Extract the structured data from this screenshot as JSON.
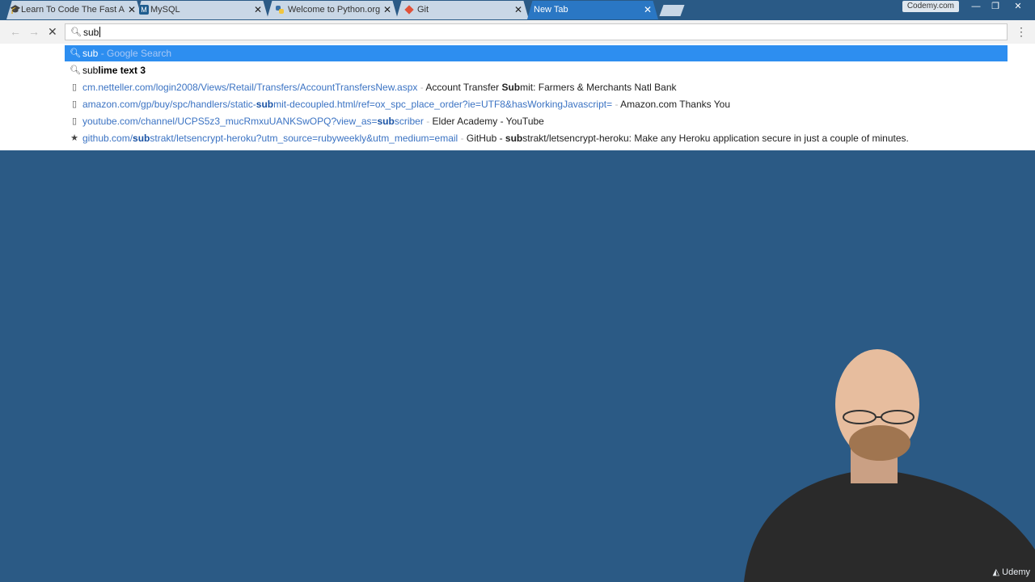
{
  "tabs": [
    {
      "title": "Learn To Code The Fast A",
      "icon": "graduation-cap-icon",
      "active": false
    },
    {
      "title": "MySQL",
      "icon": "mysql-icon",
      "active": false
    },
    {
      "title": "Welcome to Python.org",
      "icon": "python-icon",
      "active": false
    },
    {
      "title": "Git",
      "icon": "git-icon",
      "active": false
    },
    {
      "title": "New Tab",
      "icon": "",
      "active": true
    }
  ],
  "window": {
    "profile_label": "Codemy.com"
  },
  "omnibox": {
    "value": "sub"
  },
  "suggestions": [
    {
      "kind": "search",
      "prefix": "sub",
      "suffix_hint": " - Google Search"
    },
    {
      "kind": "search",
      "prefix": "sub",
      "completion": "lime text 3"
    },
    {
      "kind": "history",
      "url_a": "cm.netteller.com/login2008/Views/Retail/Transfers/AccountTransfersNew.aspx",
      "sep": " - ",
      "title_a": "Account Transfer ",
      "title_b": "Sub",
      "title_c": "mit: Farmers & Merchants Natl Bank"
    },
    {
      "kind": "history",
      "url_a": "amazon.com/gp/buy/spc/handlers/static-",
      "url_b": "sub",
      "url_c": "mit-decoupled.html/ref=ox_spc_place_order?ie=UTF8&hasWorkingJavascript=",
      "sep": " - ",
      "title": "Amazon.com Thanks You"
    },
    {
      "kind": "history",
      "url_a": "youtube.com/channel/UCPS5z3_mucRmxuUANKSwOPQ?view_as=",
      "url_b": "sub",
      "url_c": "scriber",
      "sep": " - ",
      "title": "Elder Academy - YouTube"
    },
    {
      "kind": "bookmark",
      "url_a": "github.com/",
      "url_b": "sub",
      "url_c": "strakt/letsencrypt-heroku?utm_source=rubyweekly&utm_medium=email",
      "sep": " - ",
      "title_a": "GitHub - ",
      "title_b": "sub",
      "title_c": "strakt/letsencrypt-heroku: Make any Heroku application secure in just a couple of minutes."
    }
  ],
  "watermark": {
    "label": "Udemy"
  }
}
